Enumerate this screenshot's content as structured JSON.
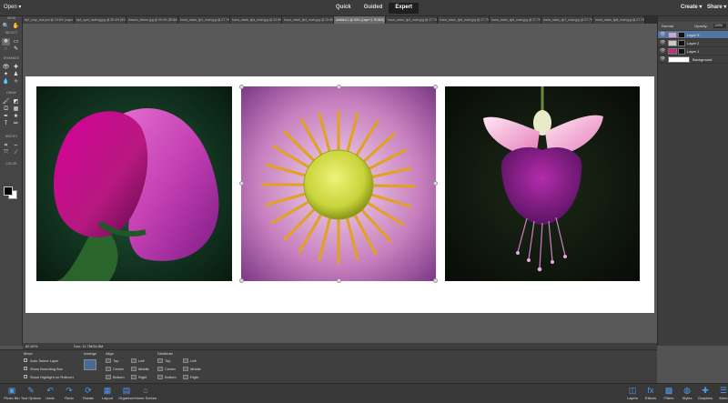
{
  "topbar": {
    "open_label": "Open ▾",
    "modes": [
      "Quick",
      "Guided",
      "Expert"
    ],
    "active_mode": "Expert",
    "create_label": "Create ▾",
    "share_label": "Share ▾"
  },
  "doc_tabs": [
    {
      "label": "tip7_crop_tool.psd @ 24.6% (Layer 0, RGB/8)"
    },
    {
      "label": "tip1_spot_healing.jpg @ 39.4% (RGB/8*)"
    },
    {
      "label": "flowers_before.jpg @ 39.4% (RGB/8*)"
    },
    {
      "label": "focus_stack_tip1_main.jpg @ 27.7% (RGB/8*)"
    },
    {
      "label": "focus_stack_tip4_main.jpg @ 23.5% (RGB/8*)"
    },
    {
      "label": "focus_stack_tip3_main.jpg @ 23.5% (RGB/8*)"
    },
    {
      "label": "Untitled-1 @ 63% (Layer 3, RGB/8)",
      "active": true
    },
    {
      "label": "focus_stack_tip2_main.jpg @ 27.7% (RGB/8*)"
    },
    {
      "label": "focus_stack_tip5_main.jpg @ 27.7% (RGB/8*)"
    },
    {
      "label": "focus_stack_tip6_main.jpg @ 27.7% (RGB/8*)"
    },
    {
      "label": "focus_stack_tip7_main.jpg @ 27.7% (RGB/8*)"
    },
    {
      "label": "focus_stack_tip8_main.jpg @ 27.7% (RGB/8*)"
    }
  ],
  "toolbox": {
    "sections": {
      "view": "VIEW",
      "select": "SELECT",
      "enhance": "ENHANCE",
      "draw": "DRAW",
      "modify": "MODIFY",
      "color": "COLOR"
    },
    "tools": [
      {
        "name": "zoom-tool-icon",
        "glyph": "🔍"
      },
      {
        "name": "hand-tool-icon",
        "glyph": "✋"
      },
      {
        "name": "move-tool-icon",
        "glyph": "✥",
        "selected": true
      },
      {
        "name": "marquee-tool-icon",
        "glyph": "▭"
      },
      {
        "name": "lasso-tool-icon",
        "glyph": "◌"
      },
      {
        "name": "quick-selection-tool-icon",
        "glyph": "✎"
      },
      {
        "name": "eye-tool-icon",
        "glyph": "👁"
      },
      {
        "name": "spot-healing-tool-icon",
        "glyph": "✚"
      },
      {
        "name": "smart-brush-tool-icon",
        "glyph": "✦"
      },
      {
        "name": "clone-stamp-tool-icon",
        "glyph": "♟"
      },
      {
        "name": "blur-tool-icon",
        "glyph": "💧"
      },
      {
        "name": "sponge-tool-icon",
        "glyph": "✧"
      },
      {
        "name": "brush-tool-icon",
        "glyph": "🖌"
      },
      {
        "name": "eraser-tool-icon",
        "glyph": "◩"
      },
      {
        "name": "paint-bucket-tool-icon",
        "glyph": "⛋"
      },
      {
        "name": "gradient-tool-icon",
        "glyph": "▦"
      },
      {
        "name": "color-picker-tool-icon",
        "glyph": "✒"
      },
      {
        "name": "custom-shape-tool-icon",
        "glyph": "★"
      },
      {
        "name": "type-tool-icon",
        "glyph": "T"
      },
      {
        "name": "pencil-tool-icon",
        "glyph": "✏"
      },
      {
        "name": "crop-tool-icon",
        "glyph": "⌗"
      },
      {
        "name": "recompose-tool-icon",
        "glyph": "⇔"
      },
      {
        "name": "content-aware-move-tool-icon",
        "glyph": "⤧"
      },
      {
        "name": "straighten-tool-icon",
        "glyph": "⟋"
      }
    ],
    "fg_color": "#000000",
    "bg_color": "#ffffff"
  },
  "layers": {
    "blend_mode": "Normal",
    "opacity_label": "Opacity:",
    "opacity_value": "100%",
    "items": [
      {
        "name": "Layer 3",
        "active": true,
        "thumb": "#c7a8d0"
      },
      {
        "name": "Layer 2",
        "active": false,
        "thumb": "#c9c9c9"
      },
      {
        "name": "Layer 1",
        "active": false,
        "thumb": "#b8327f"
      },
      {
        "name": "Background",
        "active": false,
        "thumb": "#ffffff",
        "background": true
      }
    ]
  },
  "status": {
    "zoom": "62.82%",
    "doc": "Doc: 11.7M/34.8M"
  },
  "options": {
    "move_label": "Move",
    "checkboxes": [
      "Auto Select Layer",
      "Show Bounding Box",
      "Show Highlight on Rollover"
    ],
    "arrange_label": "Arrange",
    "align_label": "Align",
    "align_items": [
      "Top",
      "Center",
      "Bottom",
      "Left",
      "Middle",
      "Right"
    ],
    "distribute_label": "Distribute",
    "distribute_items": [
      "Top",
      "Center",
      "Bottom",
      "Left",
      "Middle",
      "Right"
    ]
  },
  "taskbar": {
    "left": [
      {
        "name": "photo-bin-button",
        "label": "Photo Bin",
        "icon": "▣"
      },
      {
        "name": "tool-options-button",
        "label": "Tool Options",
        "icon": "✎"
      },
      {
        "name": "undo-button",
        "label": "Undo",
        "icon": "↶"
      },
      {
        "name": "redo-button",
        "label": "Redo",
        "icon": "↷"
      },
      {
        "name": "rotate-button",
        "label": "Rotate",
        "icon": "⟳"
      },
      {
        "name": "layout-button",
        "label": "Layout",
        "icon": "▦"
      },
      {
        "name": "organizer-button",
        "label": "Organizer",
        "icon": "▤"
      },
      {
        "name": "home-screen-button",
        "label": "Home Screen",
        "icon": "⌂"
      }
    ],
    "right": [
      {
        "name": "layers-button",
        "label": "Layers",
        "icon": "◫"
      },
      {
        "name": "effects-button",
        "label": "Effects",
        "icon": "fx"
      },
      {
        "name": "filters-button",
        "label": "Filters",
        "icon": "▩"
      },
      {
        "name": "styles-button",
        "label": "Styles",
        "icon": "◍"
      },
      {
        "name": "graphics-button",
        "label": "Graphics",
        "icon": "✚"
      },
      {
        "name": "more-button",
        "label": "More",
        "icon": "☰"
      }
    ]
  }
}
